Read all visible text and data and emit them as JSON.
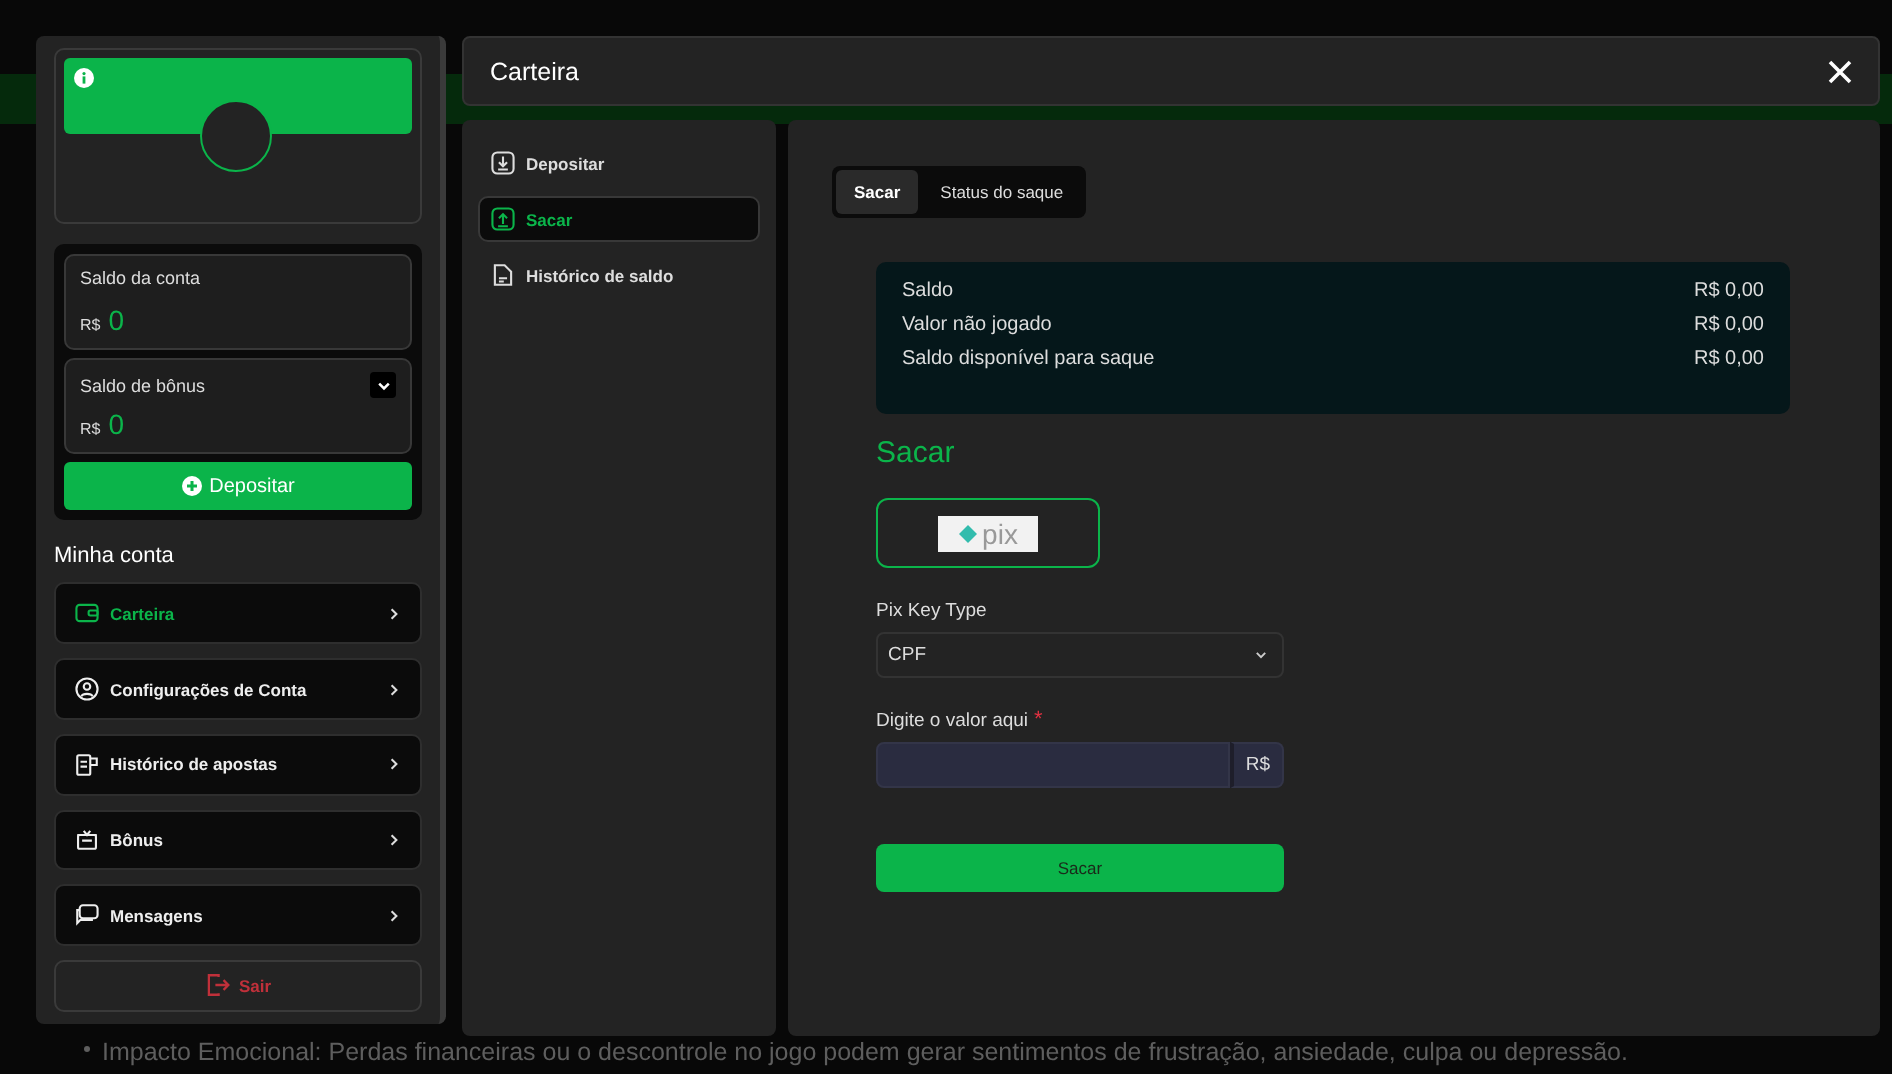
{
  "background_page": {
    "bullet": "Impacto Emocional: Perdas financeiras ou o descontrole no jogo podem gerar sentimentos de frustração, ansiedade, culpa ou depressão."
  },
  "sidebar": {
    "balances": [
      {
        "label": "Saldo da conta",
        "currency": "R$",
        "value": "0",
        "expandable": false
      },
      {
        "label": "Saldo de bônus",
        "currency": "R$",
        "value": "0",
        "expandable": true
      }
    ],
    "deposit_button": "Depositar",
    "section_title": "Minha conta",
    "items": [
      {
        "label": "Carteira",
        "kind": "wallet",
        "selected": true
      },
      {
        "label": "Configurações de Conta",
        "kind": "user",
        "selected": false
      },
      {
        "label": "Histórico de apostas",
        "kind": "receipt",
        "selected": false
      },
      {
        "label": "Bônus",
        "kind": "gift",
        "selected": false
      },
      {
        "label": "Mensagens",
        "kind": "chat",
        "selected": false
      }
    ],
    "logout": "Sair"
  },
  "modal": {
    "title": "Carteira",
    "nav": [
      {
        "label": "Depositar",
        "kind": "download",
        "selected": false
      },
      {
        "label": "Sacar",
        "kind": "upload",
        "selected": true
      },
      {
        "label": "Histórico de saldo",
        "kind": "document",
        "selected": false
      }
    ],
    "tabs": [
      {
        "label": "Sacar",
        "selected": true
      },
      {
        "label": "Status do saque",
        "selected": false
      }
    ],
    "summary": [
      {
        "label": "Saldo",
        "value": "R$ 0,00"
      },
      {
        "label": "Valor não jogado",
        "value": "R$ 0,00"
      },
      {
        "label": "Saldo disponível para saque",
        "value": "R$ 0,00"
      }
    ],
    "heading": "Sacar",
    "payment_methods": [
      {
        "logo": "pix",
        "selected": true
      }
    ],
    "pix_key_type": {
      "label": "Pix Key Type",
      "value": "CPF"
    },
    "amount": {
      "label": "Digite o valor aqui",
      "required_mark": "*",
      "currency": "R$"
    },
    "submit": "Sacar"
  }
}
